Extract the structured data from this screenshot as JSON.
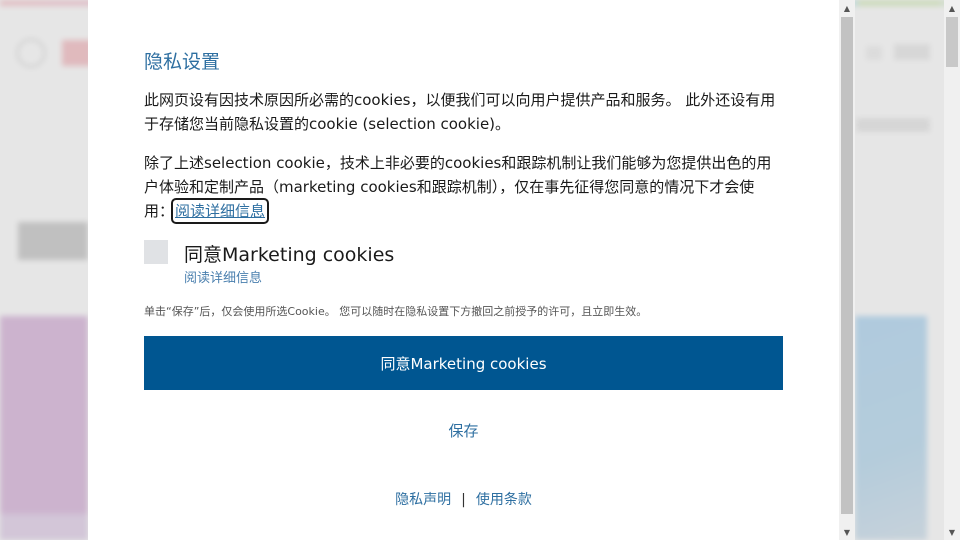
{
  "dialog": {
    "title": "隐私设置",
    "para1": "此网页设有因技术原因所必需的cookies，以便我们可以向用户提供产品和服务。 此外还设有用于存储您当前隐私设置的cookie (selection cookie)。",
    "para2": "除了上述selection cookie，技术上非必要的cookies和跟踪机制让我们能够为您提供出色的用户体验和定制产品（marketing cookies和跟踪机制），仅在事先征得您同意的情况下才会使用：",
    "read_more_link": "阅读详细信息",
    "checkbox_label": "同意Marketing cookies",
    "checkbox_checked": false,
    "checkbox_sub_link": "阅读详细信息",
    "note": "单击“保存”后，仅会使用所选Cookie。 您可以随时在隐私设置下方撤回之前授予的许可，且立即生效。",
    "primary_button": "同意Marketing cookies",
    "save_button": "保存",
    "footer": {
      "privacy_link": "隐私声明",
      "separator": "|",
      "terms_link": "使用条款"
    }
  },
  "colors": {
    "accent": "#2e6fa1",
    "primary_button": "#005691",
    "overlay": "#dcdcdc"
  },
  "icons": {
    "scroll_up": "triangle-up-icon",
    "scroll_down": "triangle-down-icon"
  }
}
